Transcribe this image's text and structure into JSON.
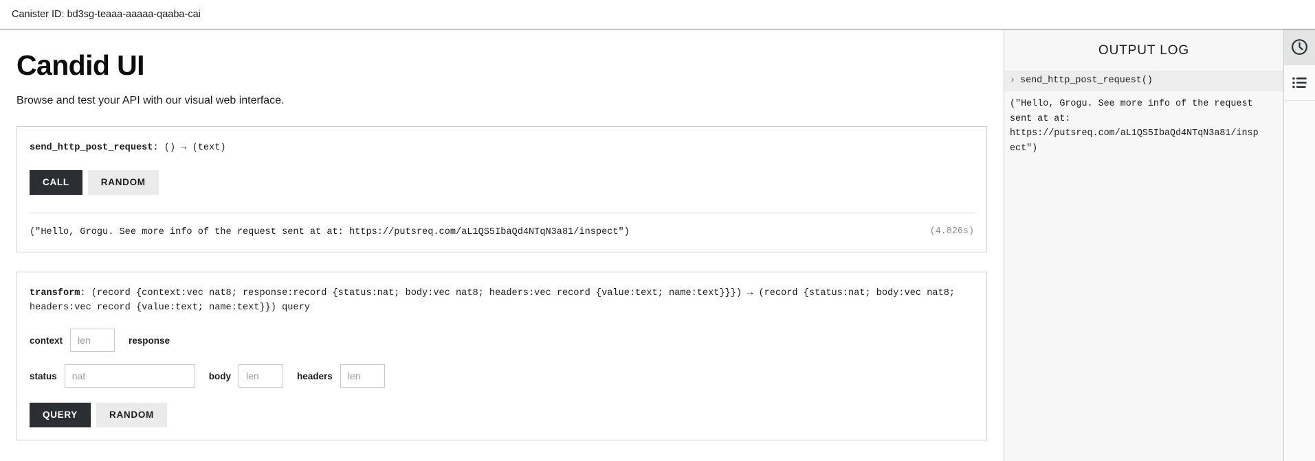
{
  "canister": {
    "label": "Canister ID: bd3sg-teaaa-aaaaa-qaaba-cai"
  },
  "header": {
    "title": "Candid UI",
    "subtitle": "Browse and test your API with our visual web interface."
  },
  "methods": [
    {
      "name": "send_http_post_request",
      "signature": ": () → (text)",
      "call_label": "CALL",
      "random_label": "RANDOM",
      "result": "(\"Hello, Grogu. See more info of the request sent at at: https://putsreq.com/aL1QS5IbaQd4NTqN3a81/inspect\")",
      "duration": "(4.826s)"
    },
    {
      "name": "transform",
      "signature": ": (record {context:vec nat8; response:record {status:nat; body:vec nat8; headers:vec record {value:text; name:text}}}) → (record {status:nat; body:vec nat8; headers:vec record {value:text; name:text}}) query",
      "query_label": "QUERY",
      "random_label": "RANDOM",
      "fields": {
        "context": {
          "label": "context",
          "value": "",
          "placeholder": "len"
        },
        "response": {
          "label": "response"
        },
        "status": {
          "label": "status",
          "value": "",
          "placeholder": "nat"
        },
        "body": {
          "label": "body",
          "value": "",
          "placeholder": "len"
        },
        "headers": {
          "label": "headers",
          "value": "",
          "placeholder": "len"
        }
      }
    }
  ],
  "output_log": {
    "title": "OUTPUT LOG",
    "caret": "›",
    "entries": [
      {
        "label": "send_http_post_request()",
        "body": "(\"Hello, Grogu. See more info of the request\nsent at at:\nhttps://putsreq.com/aL1QS5IbaQd4NTqN3a81/insp\nect\")"
      }
    ]
  },
  "rail": {
    "clock_icon": "clock-icon",
    "list_icon": "list-icon"
  },
  "colors": {
    "primary_button": "#2b2f33",
    "secondary_button": "#ebebeb",
    "log_background": "#f7f7f7",
    "muted_text": "#8d8d8d"
  }
}
